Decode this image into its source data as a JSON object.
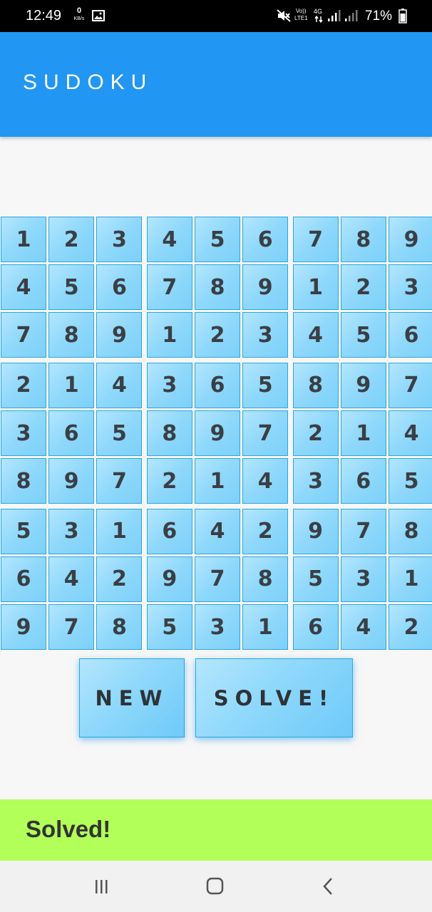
{
  "status_bar": {
    "time": "12:49",
    "net_speed_value": "0",
    "net_speed_unit": "KB/s",
    "network_label_top": "Vo))",
    "network_label_bottom": "LTE1",
    "network_type": "4G",
    "battery_percent": "71%"
  },
  "app_bar": {
    "title": "SUDOKU"
  },
  "board": {
    "rows": [
      [
        "1",
        "2",
        "3",
        "4",
        "5",
        "6",
        "7",
        "8",
        "9"
      ],
      [
        "4",
        "5",
        "6",
        "7",
        "8",
        "9",
        "1",
        "2",
        "3"
      ],
      [
        "7",
        "8",
        "9",
        "1",
        "2",
        "3",
        "4",
        "5",
        "6"
      ],
      [
        "2",
        "1",
        "4",
        "3",
        "6",
        "5",
        "8",
        "9",
        "7"
      ],
      [
        "3",
        "6",
        "5",
        "8",
        "9",
        "7",
        "2",
        "1",
        "4"
      ],
      [
        "8",
        "9",
        "7",
        "2",
        "1",
        "4",
        "3",
        "6",
        "5"
      ],
      [
        "5",
        "3",
        "1",
        "6",
        "4",
        "2",
        "9",
        "7",
        "8"
      ],
      [
        "6",
        "4",
        "2",
        "9",
        "7",
        "8",
        "5",
        "3",
        "1"
      ],
      [
        "9",
        "7",
        "8",
        "5",
        "3",
        "1",
        "6",
        "4",
        "2"
      ]
    ]
  },
  "buttons": {
    "new_label": "NEW",
    "solve_label": "SOLVE!"
  },
  "status": {
    "message": "Solved!"
  },
  "colors": {
    "app_bar": "#2196f3",
    "cell_fill": "#8fd8fb",
    "status_strip": "#b2ff59"
  }
}
